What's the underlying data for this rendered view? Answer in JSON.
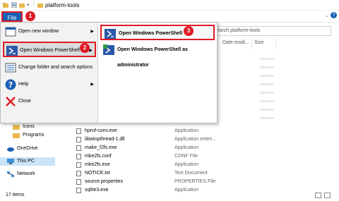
{
  "window": {
    "title": "platform-tools"
  },
  "ribbon": {
    "file_tab": "File"
  },
  "search": {
    "placeholder": "Search platform-tools"
  },
  "columns": {
    "date": "Date modi...",
    "size": "Size"
  },
  "file_menu": {
    "items": [
      {
        "label": "Open new window",
        "icon": "window-icon"
      },
      {
        "label": "Open Windows PowerShell",
        "icon": "powershell-icon"
      },
      {
        "label": "Change folder and search options",
        "icon": "options-icon"
      },
      {
        "label": "Help",
        "icon": "help-icon"
      },
      {
        "label": "Close",
        "icon": "close-icon"
      }
    ],
    "submenu": [
      {
        "label": "Open Windows PowerShell",
        "icon": "powershell-icon"
      },
      {
        "label": "Open Windows PowerShell as administrator",
        "icon": "powershell-admin-icon"
      }
    ]
  },
  "badges": [
    "1",
    "2",
    "3"
  ],
  "nav": {
    "items": [
      {
        "label": "Icons"
      },
      {
        "label": "Programs"
      },
      {
        "label": "OneDrive"
      },
      {
        "label": "This PC"
      },
      {
        "label": "Network"
      }
    ]
  },
  "files": [
    {
      "name": "hprof-conv.exe",
      "type": "Application"
    },
    {
      "name": "libwinpthread-1.dll",
      "type": "Application exten..."
    },
    {
      "name": "make_f2fs.exe",
      "type": "Application"
    },
    {
      "name": "mke2fs.conf",
      "type": "CONF File"
    },
    {
      "name": "mke2fs.exe",
      "type": "Application"
    },
    {
      "name": "NOTICE.txt",
      "type": "Text Document"
    },
    {
      "name": "source.properties",
      "type": "PROPERTIES File"
    },
    {
      "name": "sqlite3.exe",
      "type": "Application"
    }
  ],
  "status": {
    "items": "17 items"
  },
  "colors": {
    "accent": "#1a5fb4",
    "highlight": "#e01b24",
    "selected": "#cce4f7"
  }
}
